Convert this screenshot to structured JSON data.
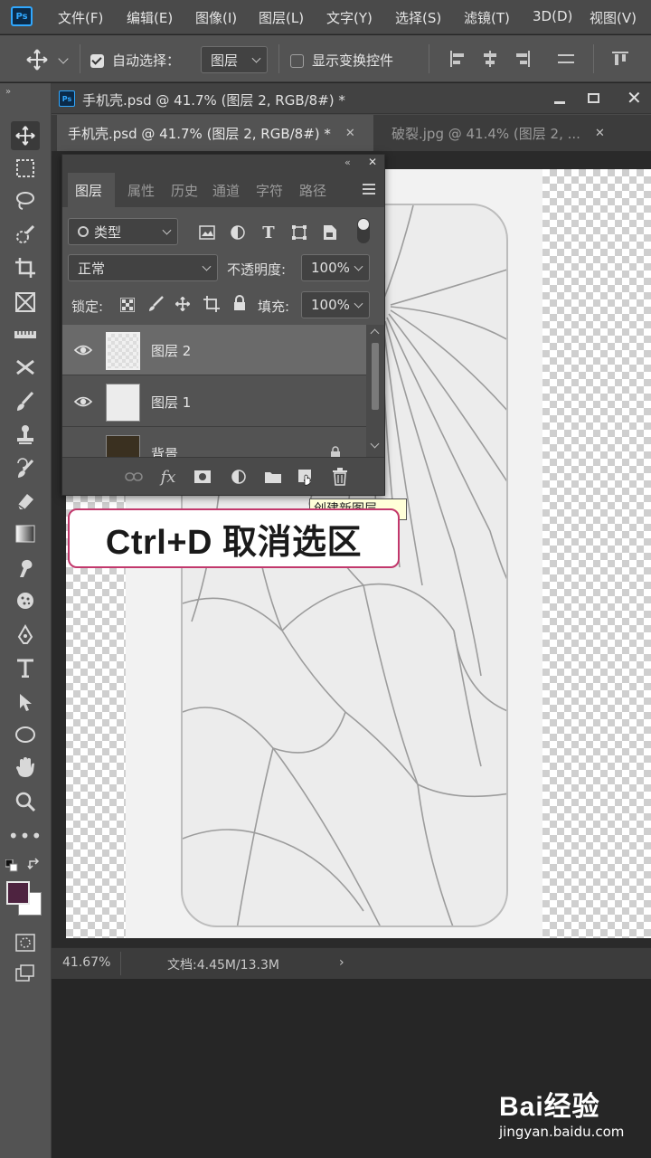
{
  "app": {
    "logo": "Ps",
    "menu": [
      "文件(F)",
      "编辑(E)",
      "图像(I)",
      "图层(L)",
      "文字(Y)",
      "选择(S)",
      "滤镜(T)",
      "3D(D)",
      "视图(V)"
    ]
  },
  "options": {
    "auto_select_label": "自动选择：",
    "auto_select_checked": true,
    "auto_select_target": "图层",
    "show_transform_label": "显示变换控件",
    "show_transform_checked": false
  },
  "document": {
    "window_title": "手机壳.psd @ 41.7% (图层 2, RGB/8#) *",
    "tabs": [
      {
        "label": "手机壳.psd @ 41.7% (图层 2, RGB/8#) *",
        "active": true
      },
      {
        "label": "破裂.jpg @ 41.4% (图层 2, ...",
        "active": false
      }
    ],
    "zoom": "41.67%",
    "doc_info": "文档:4.45M/13.3M"
  },
  "layers_panel": {
    "tabs": [
      "图层",
      "属性",
      "历史",
      "通道",
      "字符",
      "路径"
    ],
    "active_tab": "图层",
    "filter_label": "类型",
    "blend_mode": "正常",
    "opacity_label": "不透明度:",
    "opacity_value": "100%",
    "lock_label": "锁定:",
    "fill_label": "填充:",
    "fill_value": "100%",
    "layers": [
      {
        "name": "图层 2",
        "visible": true,
        "selected": true
      },
      {
        "name": "图层 1",
        "visible": true,
        "selected": false
      },
      {
        "name": "背景",
        "visible": false,
        "selected": false
      }
    ],
    "footer_icons": [
      "link-icon",
      "fx-icon",
      "mask-icon",
      "adjustment-icon",
      "folder-icon",
      "new-layer-icon",
      "trash-icon"
    ]
  },
  "tooltip": "创建新图层",
  "caption": "Ctrl+D  取消选区",
  "watermark": {
    "main": "Bai经验",
    "sub": "jingyan.baidu.com"
  },
  "colors": {
    "foreground": "#4e2340",
    "background": "#ffffff",
    "caption_border": "#c2386c"
  }
}
